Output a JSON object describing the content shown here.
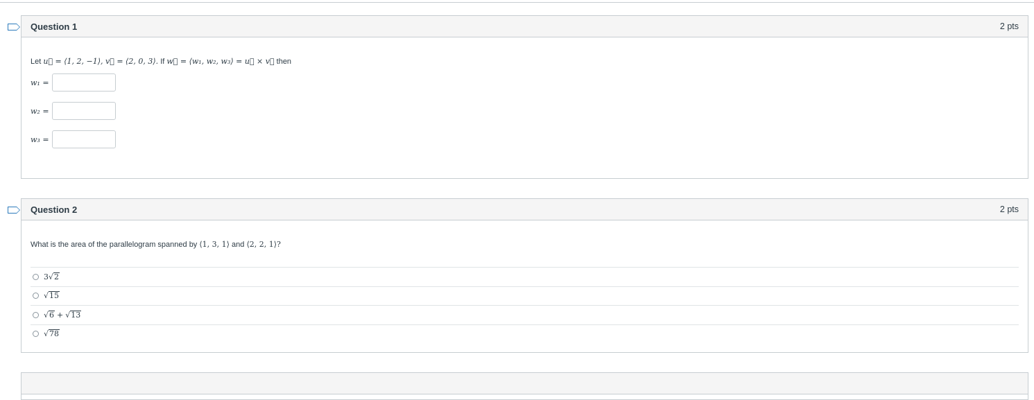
{
  "questions": [
    {
      "title": "Question 1",
      "points": "2 pts",
      "prompt_prefix": "Let",
      "prompt_u": "u⃗ = ⟨1, 2, −1⟩, v⃗ = ⟨2, 0, 3⟩.",
      "prompt_if": "If",
      "prompt_w": "w⃗ = ⟨w₁, w₂, w₃⟩ = u⃗ × v⃗",
      "prompt_suffix": "then",
      "fields": [
        {
          "label": "w₁ =",
          "value": "",
          "placeholder": ""
        },
        {
          "label": "w₂ =",
          "value": "",
          "placeholder": ""
        },
        {
          "label": "w₃ =",
          "value": "",
          "placeholder": ""
        }
      ]
    },
    {
      "title": "Question 2",
      "points": "2 pts",
      "prompt_text": "What is the area of the parallelogram spanned by",
      "prompt_vec1": "⟨1, 3, 1⟩",
      "prompt_and": "and",
      "prompt_vec2": "⟨2, 2, 1⟩?",
      "choices": [
        {
          "coef": "3",
          "radicand": "2"
        },
        {
          "coef": "",
          "radicand": "15"
        },
        {
          "coef": "",
          "radicand": "6",
          "plus_radicand": "13"
        },
        {
          "coef": "",
          "radicand": "78"
        }
      ]
    }
  ],
  "colors": {
    "border": "#c7cdd1",
    "header_bg": "#f5f5f5",
    "flag": "#2b7abc",
    "text": "#2d3b45"
  },
  "icons": {
    "flag": "flag-outline-icon",
    "radio": "radio-unchecked-icon"
  }
}
